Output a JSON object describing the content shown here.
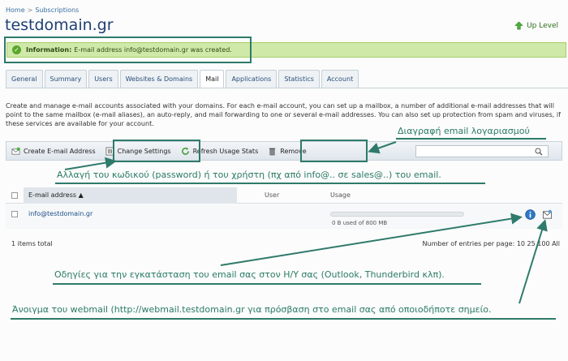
{
  "breadcrumb": {
    "home": "Home",
    "separator": ">",
    "subscriptions": "Subscriptions"
  },
  "page_title": "testdomain.gr",
  "up_level": "Up Level",
  "message": {
    "label": "Information:",
    "text": "E-mail address info@testdomain.gr was created."
  },
  "tabs": [
    {
      "label": "General"
    },
    {
      "label": "Summary"
    },
    {
      "label": "Users"
    },
    {
      "label": "Websites & Domains"
    },
    {
      "label": "Mail",
      "active": true
    },
    {
      "label": "Applications"
    },
    {
      "label": "Statistics"
    },
    {
      "label": "Account"
    }
  ],
  "description": "Create and manage e-mail accounts associated with your domains. For each e-mail account, you can set up a mailbox, a number of additional e-mail addresses that will point to the same mailbox (e-mail aliases), an auto-reply, and mail forwarding to one or several e-mail addresses. You can also set up protection from spam and viruses, if these services are available for your account.",
  "toolbar": {
    "create": "Create E-mail Address",
    "change": "Change Settings",
    "refresh": "Refresh Usage Stats",
    "remove": "Remove"
  },
  "table": {
    "headers": {
      "email": "E-mail address",
      "sort_arrow": "▲",
      "user": "User",
      "usage": "Usage"
    },
    "rows": [
      {
        "email": "info@testdomain.gr",
        "user": "",
        "usage": "0 B used of 800 MB",
        "usage_fraction": 0
      }
    ]
  },
  "footer": {
    "total": "1 items total",
    "per_page_label": "Number of entries per page:",
    "per_page_options": "10 25 100 All"
  },
  "annotations": {
    "delete": "Διαγραφή email λογαριασμού",
    "change": "Αλλαγή του κωδικού (password) ή του χρήστη (πχ από info@.. σε sales@..) του email.",
    "instructions": "Οδηγίες για την εγκατάσταση του email σας στον Η/Υ σας (Outlook, Thunderbird κλπ).",
    "webmail": "Άνοιγμα του webmail (http://webmail.testdomain.gr για πρόσβαση στο email σας από οποιοδήποτε σημείο."
  },
  "colors": {
    "annotation": "#2f7a6b",
    "message_bg": "#cfe9a8",
    "title": "#1f3f74",
    "link": "#1f4f8a"
  }
}
